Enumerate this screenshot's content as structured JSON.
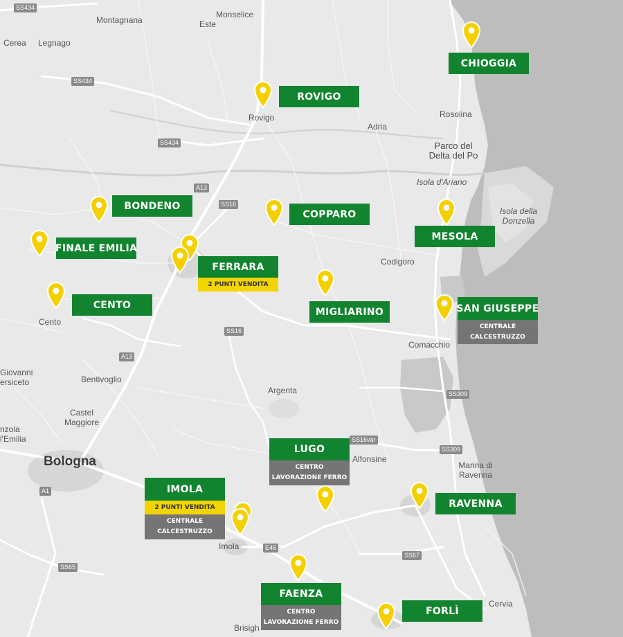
{
  "colors": {
    "land": "#e9e9e9",
    "sea": "#bdbdbd",
    "road": "#ffffff",
    "label_green": "#12842f",
    "label_yellow": "#f2d400",
    "label_gray": "#757575",
    "pin_yellow": "#f5d000"
  },
  "places": {
    "monselice": "Monselice",
    "montagnana": "Montagnana",
    "este": "Este",
    "cerea": "Cerea",
    "legnago": "Legnago",
    "rovigo": "Rovigo",
    "adria": "Adria",
    "rosolina": "Rosolina",
    "parco_delta_1": "Parco del",
    "parco_delta_2": "Delta del Po",
    "isola_ariano": "Isola d'Ariano",
    "isola_donzella_1": "Isola della",
    "isola_donzella_2": "Donzella",
    "codigoro": "Codigoro",
    "comacchio": "Comacchio",
    "cento": "Cento",
    "giovanni_1": "Giovanni",
    "giovanni_2": "ersiceto",
    "bentivoglio": "Bentivoglio",
    "argenta": "Argenta",
    "castel_maggiore_1": "Castel",
    "castel_maggiore_2": "Maggiore",
    "anzola_1": "nzola",
    "anzola_2": "l'Emilia",
    "bologna": "Bologna",
    "alfonsine": "Alfonsine",
    "marina_ravenna_1": "Marina di",
    "marina_ravenna_2": "Ravenna",
    "imola": "Imola",
    "cervia": "Cervia",
    "brisighella": "Brisigh"
  },
  "roads": {
    "ss434_a": "SS434",
    "ss434_b": "SS434",
    "ss434_c": "SS434",
    "a13_a": "A13",
    "a13_b": "A13",
    "ss16_a": "SS16",
    "ss16_b": "SS16",
    "ss309_a": "SS309",
    "ss309_b": "SS309",
    "ss16var": "SS16var",
    "a1": "A1",
    "e45": "E45",
    "ss67": "SS67",
    "ss65": "SS65"
  },
  "locations": [
    {
      "id": "chioggia",
      "name": "CHIOGGIA"
    },
    {
      "id": "rovigo",
      "name": "ROVIGO"
    },
    {
      "id": "bondeno",
      "name": "BONDENO"
    },
    {
      "id": "copparo",
      "name": "COPPARO"
    },
    {
      "id": "mesola",
      "name": "MESOLA"
    },
    {
      "id": "finale-emilia",
      "name": "FINALE EMILIA"
    },
    {
      "id": "ferrara",
      "name": "FERRARA",
      "badge": "2 PUNTI VENDITA"
    },
    {
      "id": "cento",
      "name": "CENTO"
    },
    {
      "id": "migliarino",
      "name": "MIGLIARINO"
    },
    {
      "id": "san-giuseppe",
      "name": "SAN GIUSEPPE",
      "service": [
        "CENTRALE",
        "CALCESTRUZZO"
      ]
    },
    {
      "id": "lugo",
      "name": "LUGO",
      "service": [
        "CENTRO",
        "LAVORAZIONE FERRO"
      ]
    },
    {
      "id": "imola",
      "name": "IMOLA",
      "badge": "2 PUNTI VENDITA",
      "service": [
        "CENTRALE",
        "CALCESTRUZZO"
      ]
    },
    {
      "id": "ravenna",
      "name": "RAVENNA"
    },
    {
      "id": "faenza",
      "name": "FAENZA",
      "service": [
        "CENTRO",
        "LAVORAZIONE FERRO"
      ]
    },
    {
      "id": "forli",
      "name": "FORLÌ"
    }
  ]
}
